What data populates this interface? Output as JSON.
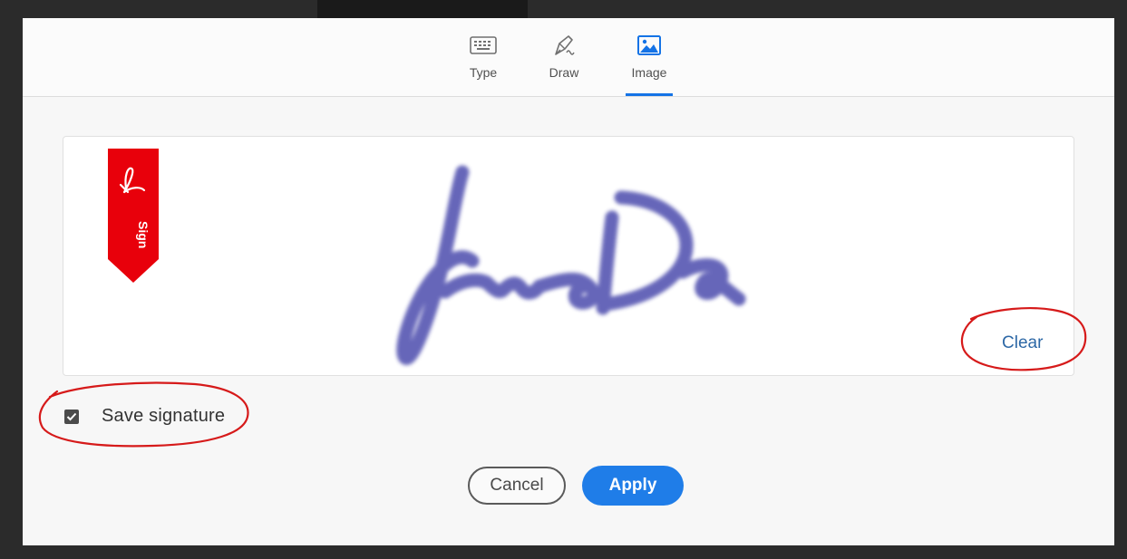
{
  "tabs": [
    {
      "label": "Type",
      "icon": "keyboard-icon"
    },
    {
      "label": "Draw",
      "icon": "pen-icon"
    },
    {
      "label": "Image",
      "icon": "image-icon",
      "active": true
    }
  ],
  "signature_area": {
    "badge_text": "Sign",
    "badge_color": "#e8000b",
    "clear_label": "Clear",
    "ink_color": "#5a5ab4"
  },
  "save_signature": {
    "label": "Save signature",
    "checked": true
  },
  "buttons": {
    "cancel": "Cancel",
    "apply": "Apply"
  },
  "colors": {
    "accent": "#1473e6",
    "annotation": "#d61a1a"
  }
}
